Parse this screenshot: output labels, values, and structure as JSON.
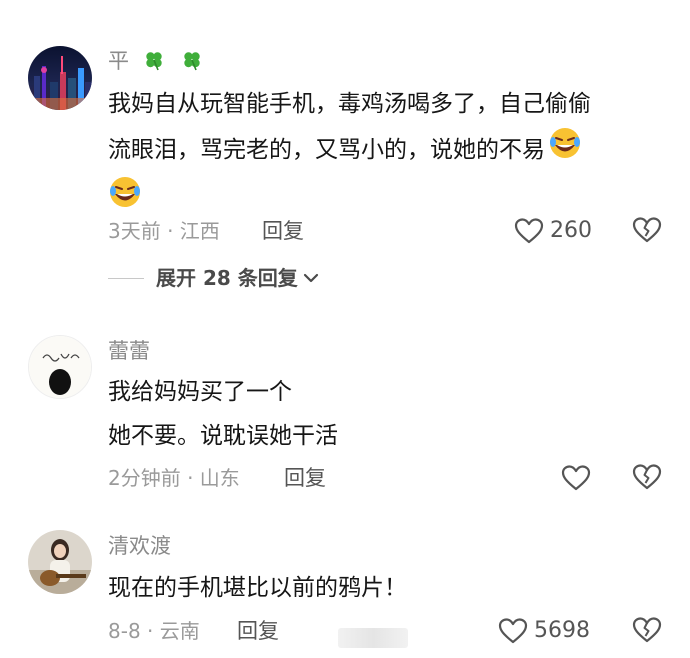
{
  "comments": [
    {
      "username": "平",
      "username_badges": [
        "four-leaf-clover",
        "four-leaf-clover"
      ],
      "lines": [
        "我妈自从玩智能手机，毒鸡汤喝多了，自己偷偷",
        "流眼泪，骂完老的，又骂小的，说她的不易"
      ],
      "trailing_emoji": "laughing-crying",
      "meta": "3天前 · 江西",
      "reply_label": "回复",
      "like_count": "260",
      "expand_label": "展开 28 条回复"
    },
    {
      "username": "蕾蕾",
      "lines": [
        "我给妈妈买了一个",
        "她不要。说耽误她干活"
      ],
      "meta": "2分钟前 · 山东",
      "reply_label": "回复",
      "like_count": ""
    },
    {
      "username": "清欢渡",
      "lines": [
        "现在的手机堪比以前的鸦片！"
      ],
      "meta": "8-8 · 云南",
      "reply_label": "回复",
      "like_count": "5698"
    }
  ],
  "icons": {
    "like": "heart-outline-icon",
    "dislike": "broken-heart-icon",
    "expand": "chevron-down-icon"
  },
  "colors": {
    "text_primary": "#161616",
    "text_secondary": "#8a8a8a",
    "clover": "#3fae3a",
    "emoji_face": "#f8c232"
  }
}
